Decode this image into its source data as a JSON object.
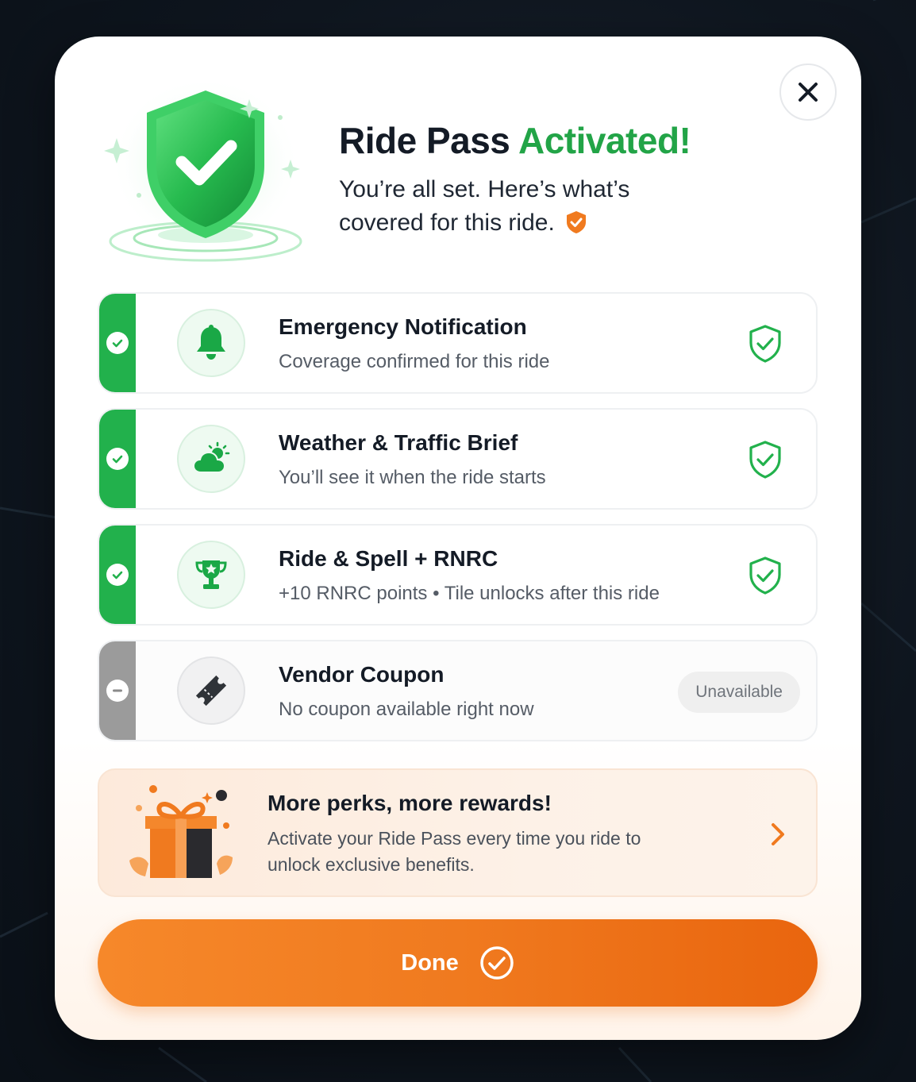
{
  "colors": {
    "green": "#22b14c",
    "orange": "#f07a1f",
    "gray": "#9b9b9b"
  },
  "header": {
    "title_main": "Ride Pass",
    "title_accent": "Activated!",
    "subtitle": "You’re all set. Here’s what’s covered for this ride."
  },
  "benefits": [
    {
      "title": "Emergency Notification",
      "subtitle": "Coverage confirmed for this ride",
      "icon": "bell-icon",
      "status": "covered"
    },
    {
      "title": "Weather & Traffic Brief",
      "subtitle": "You’ll see it when the ride starts",
      "icon": "weather-icon",
      "status": "covered"
    },
    {
      "title": "Ride & Spell + RNRC",
      "subtitle": "+10 RNRC points • Tile unlocks after this ride",
      "icon": "trophy-icon",
      "status": "covered"
    },
    {
      "title": "Vendor Coupon",
      "subtitle": "No coupon available right now",
      "icon": "ticket-icon",
      "status": "unavailable",
      "badge": "Unavailable"
    }
  ],
  "promo": {
    "title": "More perks, more rewards!",
    "body": "Activate your Ride Pass every time you ride to unlock exclusive benefits."
  },
  "done_button": {
    "label": "Done"
  }
}
